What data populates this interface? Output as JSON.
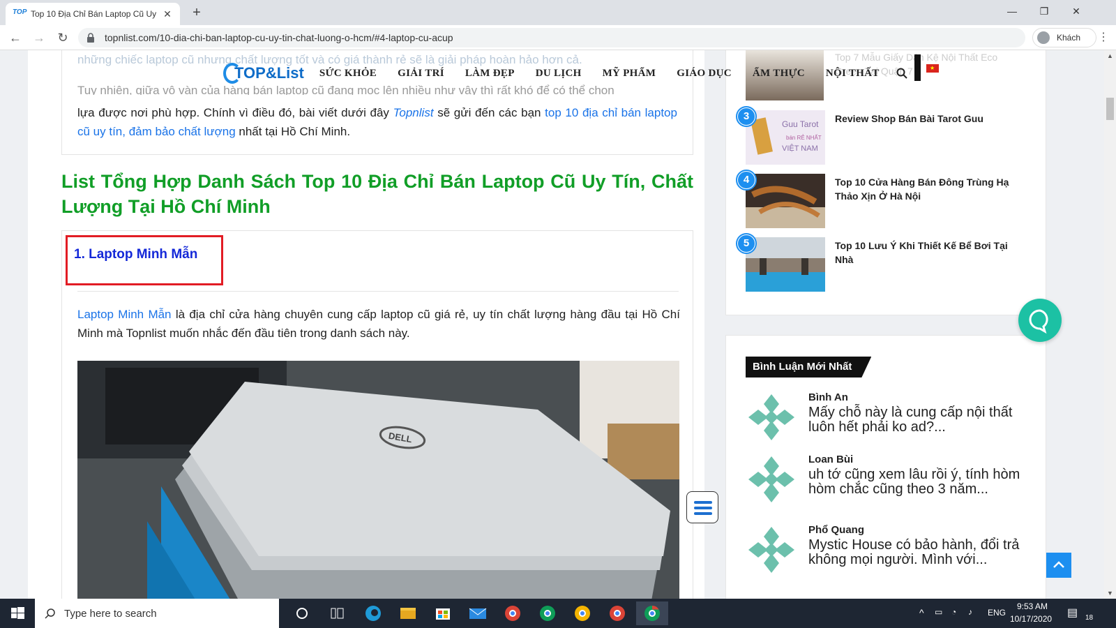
{
  "browser": {
    "tab_title": "Top 10 Địa Chỉ Bán Laptop Cũ Uy",
    "favicon_text": "TOP",
    "url": "topnlist.com/10-dia-chi-ban-laptop-cu-uy-tin-chat-luong-o-hcm/#4-laptop-cu-acup",
    "profile_label": "Khách",
    "icons": [
      "back-icon",
      "forward-icon",
      "reload-icon",
      "lock-icon",
      "menu-dots-icon"
    ]
  },
  "site": {
    "logo_text": "TOP&List",
    "nav": [
      "SỨC KHỎE",
      "GIẢI TRÍ",
      "LÀM ĐẸP",
      "DU LỊCH",
      "MỸ PHẨM",
      "GIÁO DỤC",
      "ẨM THỰC",
      "NỘI THẤT"
    ]
  },
  "article": {
    "intro_faded": "những chiếc laptop cũ nhưng chất lượng tốt và có giá thành rẻ sẽ là giải pháp hoàn hảo hơn cả.",
    "intro_cut": "Tuy nhiên, giữa vô vàn của hàng bán laptop cũ đang mọc lên nhiều như vậy thì rất khó để có thể chọn",
    "intro_p1": "lựa được nơi phù hợp. Chính vì điều đó, bài viết dưới đây",
    "intro_brand": "Topnlist",
    "intro_p2": "sẽ gửi đến các bạn",
    "intro_link": "top 10 địa chỉ bán laptop cũ uy tín, đảm bảo chất lượng",
    "intro_p3": "nhất tại Hồ Chí Minh.",
    "section_title": "List Tổng Hợp Danh Sách Top 10 Địa Chỉ Bán Laptop Cũ Uy Tín, Chất Lượng Tại Hồ Chí Minh",
    "item_title": "1. Laptop Minh Mẫn",
    "item_link": "Laptop Minh Mẫn",
    "item_desc": "là địa chỉ cửa hàng chuyên cung cấp laptop cũ giá rẻ, uy tín chất lượng hàng đầu tại Hồ Chí Minh mà Topnlist muốn nhắc đến đầu tiên trong danh sách này.",
    "image_brand": "DELL"
  },
  "sidebar": {
    "faded_text": "Top 7 Mẫu Giấy Dán Kệ Nội Thất Eco Green Tại Quận 7",
    "ranked": [
      {
        "num": "3",
        "title": "Review Shop Bán Bài Tarot Guu",
        "thumb_text": "Guu Tarot",
        "thumb_sub": "bán RẺ NHẤT VIỆT NAM"
      },
      {
        "num": "4",
        "title": "Top 10 Cửa Hàng Bán Đông Trùng Hạ Thảo Xịn Ở Hà Nội"
      },
      {
        "num": "5",
        "title": "Top 10 Lưu Ý Khi Thiết Kế Bể Bơi Tại Nhà"
      }
    ],
    "comments_heading": "Bình Luận Mới Nhất",
    "comments": [
      {
        "name": "Bình An",
        "text": "Mấy chỗ này là cung cấp nội thất luôn hết phải ko ad?..."
      },
      {
        "name": "Loan Bùi",
        "text": "uh tớ cũng xem lâu rồi ý, tính hòm hòm chắc cũng theo 3 năm..."
      },
      {
        "name": "Phổ Quang",
        "text": "Mystic House có bảo hành, đổi trả không mọi người. Mình với..."
      }
    ]
  },
  "taskbar": {
    "search_placeholder": "Type here to search",
    "lang": "ENG",
    "time": "9:53 AM",
    "date": "10/17/2020",
    "notif_count": "18"
  }
}
